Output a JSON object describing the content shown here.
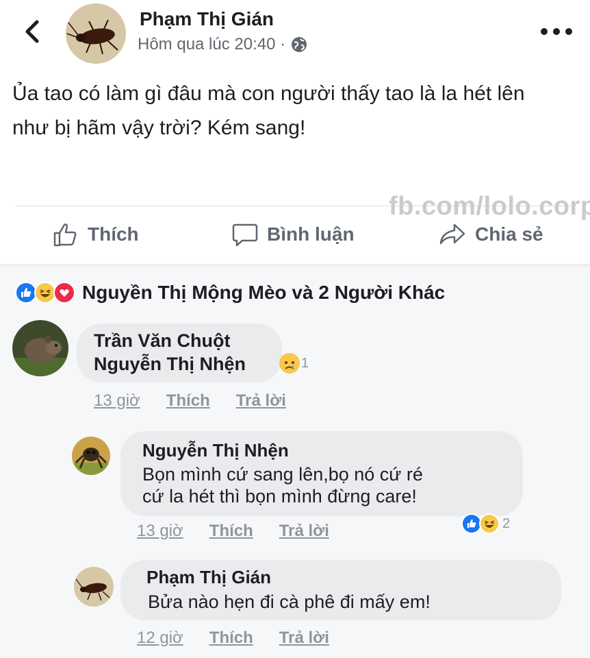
{
  "post": {
    "author": "Phạm Thị Gián",
    "timestamp": "Hôm qua lúc 20:40 ·",
    "privacy_icon": "globe-icon",
    "text": "Ủa tao có làm gì đâu mà con người thấy tao là la hét lên như bị hãm vậy trời? Kém sang!",
    "watermark": "fb.com/lolo.corp"
  },
  "actions": {
    "like_label": "Thích",
    "comment_label": "Bình luận",
    "share_label": "Chia sẻ"
  },
  "reactions": {
    "icons": [
      "like-icon",
      "haha-icon",
      "love-icon"
    ],
    "summary": "Nguyền Thị Mộng Mèo và 2 Người Khác"
  },
  "comments": [
    {
      "author": "Trần Văn Chuột",
      "text": "Nguyễn Thị Nhện",
      "reaction_count": "1",
      "time": "13 giờ",
      "like": "Thích",
      "reply": "Trả lời"
    },
    {
      "author": "Nguyễn Thị Nhện",
      "text_line1": "Bọn mình cứ sang lên,bọ nó cứ ré",
      "text_line2": "cứ la hét thì bọn mình đừng care!",
      "reaction_count": "2",
      "time": "13 giờ",
      "like": "Thích",
      "reply": "Trả lời"
    },
    {
      "author": "Phạm Thị Gián",
      "text": "Bửa nào hẹn đi cà phê đi mấy em!",
      "time": "12 giờ",
      "like": "Thích",
      "reply": "Trả lời"
    }
  ],
  "colors": {
    "like_blue": "#1877f2",
    "haha_yellow": "#f7c84a",
    "love_red": "#f0284a",
    "bubble_gray": "#eaebed"
  }
}
